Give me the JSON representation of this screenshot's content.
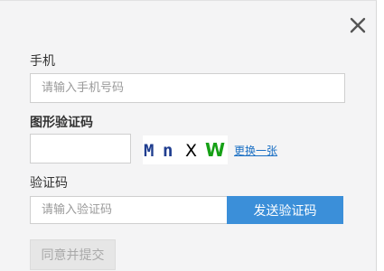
{
  "dialog": {
    "close_icon": "close-icon",
    "phone": {
      "label": "手机",
      "placeholder": "请输入手机号码",
      "value": ""
    },
    "image_captcha": {
      "label": "图形验证码",
      "placeholder": "",
      "value": "",
      "captcha_text": "Mn X W",
      "captcha_chars": [
        "M",
        "n",
        "X",
        "W"
      ],
      "char_colors": [
        "#1f3d8f",
        "#1f3d8f",
        "#000000",
        "#16a016"
      ],
      "refresh_link": "更换一张"
    },
    "sms_code": {
      "label": "验证码",
      "placeholder": "请输入验证码",
      "value": "",
      "send_button": "发送验证码"
    },
    "submit_button": "同意并提交",
    "colors": {
      "accent": "#3b8fd9",
      "link": "#1a6fc4",
      "panel_bg": "#f4f4f5",
      "disabled_bg": "#e6e6e6"
    }
  }
}
